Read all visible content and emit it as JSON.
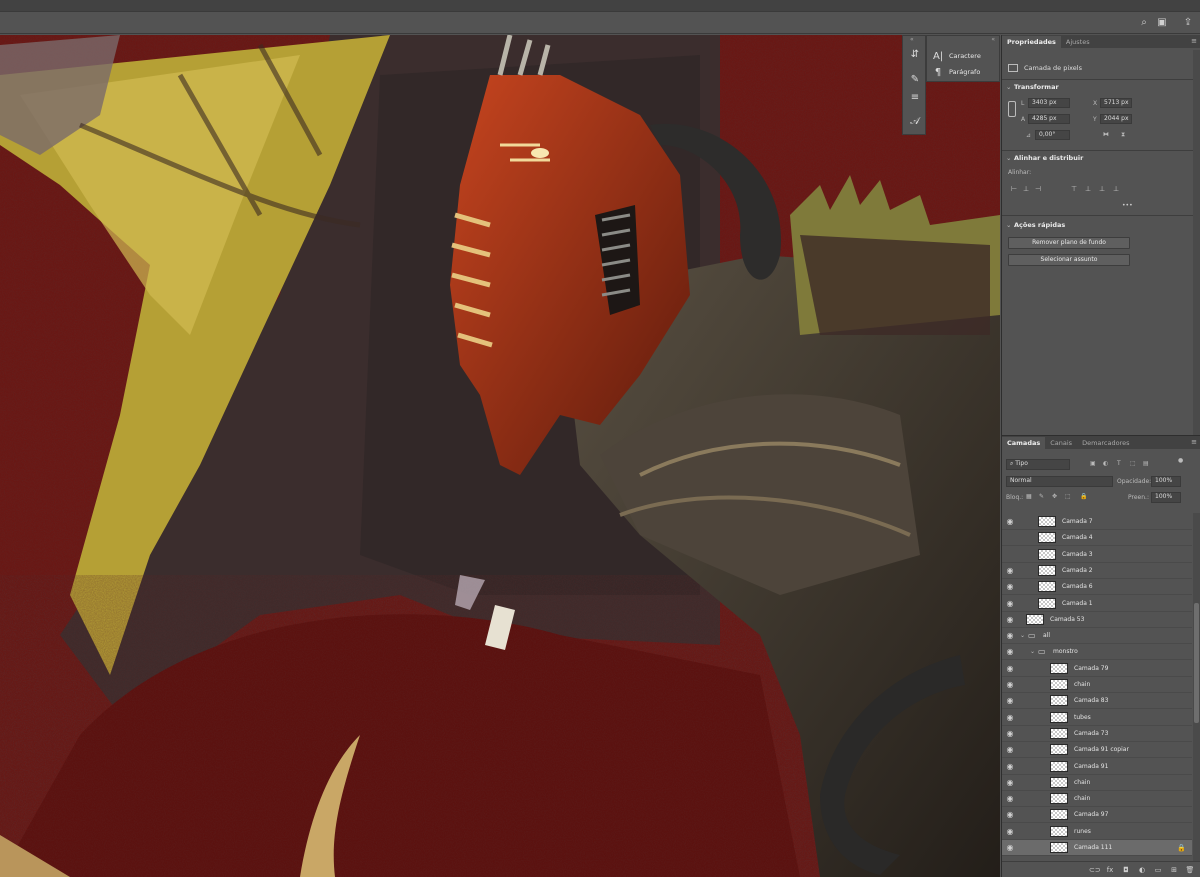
{
  "topbar": {
    "icons": [
      "search-icon",
      "workspace-icon",
      "share-icon"
    ],
    "search_glyph": "⌕",
    "workspace_glyph": "▣",
    "share_glyph": "⇪"
  },
  "mini_panel": {
    "collapse_glyph": "«",
    "tools": [
      {
        "icon": "history-icon",
        "glyph": "⇵"
      },
      {
        "icon": "brush-icon",
        "glyph": "✎"
      },
      {
        "icon": "adjustments-icon",
        "glyph": "≡"
      },
      {
        "icon": "glyph-icon",
        "glyph": "𝒜"
      }
    ]
  },
  "char_panel": {
    "collapse_glyph": "«",
    "items": [
      {
        "label": "Caractere",
        "icon": "character-icon",
        "glyph": "A|"
      },
      {
        "label": "Parágrafo",
        "icon": "paragraph-icon",
        "glyph": "¶"
      }
    ]
  },
  "properties": {
    "tabs": [
      {
        "label": "Propriedades",
        "active": true
      },
      {
        "label": "Ajustes",
        "active": false
      }
    ],
    "menu_glyph": "≡",
    "layer_type": "Camada de pixels",
    "transform": {
      "title": "Transformar",
      "L_label": "L",
      "L_value": "3403 px",
      "X_label": "X",
      "X_value": "5713 px",
      "A_label": "A",
      "A_value": "4285 px",
      "Y_label": "Y",
      "Y_value": "2044 px",
      "angle_value": "0,00°"
    },
    "align": {
      "title": "Alinhar e distribuir",
      "subtitle": "Alinhar:",
      "more": "•••"
    },
    "quick": {
      "title": "Ações rápidas",
      "buttons": [
        "Remover plano de fundo",
        "Selecionar assunto"
      ]
    }
  },
  "layers": {
    "tabs": [
      {
        "label": "Camadas",
        "active": true
      },
      {
        "label": "Canais",
        "active": false
      },
      {
        "label": "Demarcadores",
        "active": false
      }
    ],
    "menu_glyph": "≡",
    "filter_label": "Tipo",
    "blend_mode": "Normal",
    "opacity_label": "Opacidade:",
    "opacity_value": "100%",
    "lock_label": "Bloq.:",
    "fill_label": "Preen.:",
    "fill_value": "100%",
    "rows": [
      {
        "name": "Camada 7",
        "visible": true,
        "indent": 1,
        "kind": "layer"
      },
      {
        "name": "Camada 4",
        "visible": false,
        "indent": 1,
        "kind": "layer"
      },
      {
        "name": "Camada 3",
        "visible": false,
        "indent": 1,
        "kind": "layer"
      },
      {
        "name": "Camada 2",
        "visible": true,
        "indent": 1,
        "kind": "layer"
      },
      {
        "name": "Camada 6",
        "visible": true,
        "indent": 1,
        "kind": "layer"
      },
      {
        "name": "Camada 1",
        "visible": true,
        "indent": 1,
        "kind": "layer"
      },
      {
        "name": "Camada 53",
        "visible": true,
        "indent": 0,
        "kind": "layer"
      },
      {
        "name": "all",
        "visible": true,
        "indent": 0,
        "kind": "folder"
      },
      {
        "name": "monstro",
        "visible": true,
        "indent": 1,
        "kind": "folder"
      },
      {
        "name": "Camada 79",
        "visible": true,
        "indent": 2,
        "kind": "layer"
      },
      {
        "name": "chain",
        "visible": true,
        "indent": 2,
        "kind": "layer"
      },
      {
        "name": "Camada 83",
        "visible": true,
        "indent": 2,
        "kind": "layer"
      },
      {
        "name": "tubes",
        "visible": true,
        "indent": 2,
        "kind": "layer"
      },
      {
        "name": "Camada 73",
        "visible": true,
        "indent": 2,
        "kind": "layer"
      },
      {
        "name": "Camada 91 copiar",
        "visible": true,
        "indent": 2,
        "kind": "layer"
      },
      {
        "name": "Camada 91",
        "visible": true,
        "indent": 2,
        "kind": "layer"
      },
      {
        "name": "chain",
        "visible": true,
        "indent": 2,
        "kind": "layer"
      },
      {
        "name": "chain",
        "visible": true,
        "indent": 2,
        "kind": "layer"
      },
      {
        "name": "Camada 97",
        "visible": true,
        "indent": 2,
        "kind": "layer"
      },
      {
        "name": "runes",
        "visible": true,
        "indent": 2,
        "kind": "layer"
      },
      {
        "name": "Camada 111",
        "visible": true,
        "indent": 2,
        "kind": "layer",
        "selected": true,
        "locked": true
      }
    ],
    "footer_icons": [
      {
        "icon": "link-icon",
        "glyph": "⊂⊃"
      },
      {
        "icon": "fx-icon",
        "glyph": "fx"
      },
      {
        "icon": "mask-icon",
        "glyph": "◘"
      },
      {
        "icon": "adjustment-layer-icon",
        "glyph": "◐"
      },
      {
        "icon": "new-group-icon",
        "glyph": "▭"
      },
      {
        "icon": "new-layer-icon",
        "glyph": "⊞"
      },
      {
        "icon": "delete-icon",
        "glyph": "🗑"
      }
    ]
  }
}
